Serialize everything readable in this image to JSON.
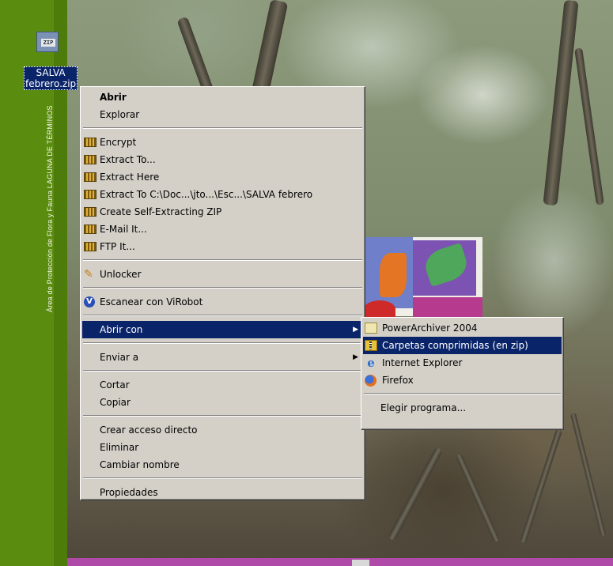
{
  "desktop": {
    "banner_text": "Área de Protección de Flora y Fauna LAGUNA DE TÉRMINOS",
    "icon": {
      "badge": "ZIP",
      "label_line1": "SALVA",
      "label_line2": "febrero.zip"
    }
  },
  "context_menu": {
    "items": [
      {
        "label": "Abrir",
        "bold": true
      },
      {
        "label": "Explorar"
      },
      {
        "label": "Encrypt",
        "icon": "powerarchiver-icon"
      },
      {
        "label": "Extract To...",
        "icon": "powerarchiver-icon"
      },
      {
        "label": "Extract Here",
        "icon": "powerarchiver-icon"
      },
      {
        "label": "Extract To C:\\Doc...\\jto...\\Esc...\\SALVA febrero",
        "icon": "powerarchiver-icon"
      },
      {
        "label": "Create Self-Extracting ZIP",
        "icon": "powerarchiver-icon"
      },
      {
        "label": "E-Mail It...",
        "icon": "powerarchiver-icon"
      },
      {
        "label": "FTP It...",
        "icon": "powerarchiver-icon"
      },
      {
        "label": "Unlocker",
        "icon": "unlocker-icon"
      },
      {
        "label": "Escanear con ViRobot",
        "icon": "virobot-icon"
      },
      {
        "label": "Abrir con",
        "submenu": true,
        "selected": true
      },
      {
        "label": "Enviar a",
        "submenu": true
      },
      {
        "label": "Cortar"
      },
      {
        "label": "Copiar"
      },
      {
        "label": "Crear acceso directo"
      },
      {
        "label": "Eliminar"
      },
      {
        "label": "Cambiar nombre"
      },
      {
        "label": "Propiedades"
      }
    ]
  },
  "open_with_menu": {
    "items": [
      {
        "label": "PowerArchiver 2004",
        "icon": "powerarchiver-icon"
      },
      {
        "label": "Carpetas comprimidas (en zip)",
        "icon": "zip-folder-icon",
        "selected": true
      },
      {
        "label": "Internet Explorer",
        "icon": "internet-explorer-icon"
      },
      {
        "label": "Firefox",
        "icon": "firefox-icon"
      },
      {
        "label": "Elegir programa..."
      }
    ]
  },
  "colors": {
    "menu_bg": "#d4d0c8",
    "selection": "#0a246a",
    "banner_green": "#5a8d0f",
    "bottom_bar": "#b04aa8"
  }
}
